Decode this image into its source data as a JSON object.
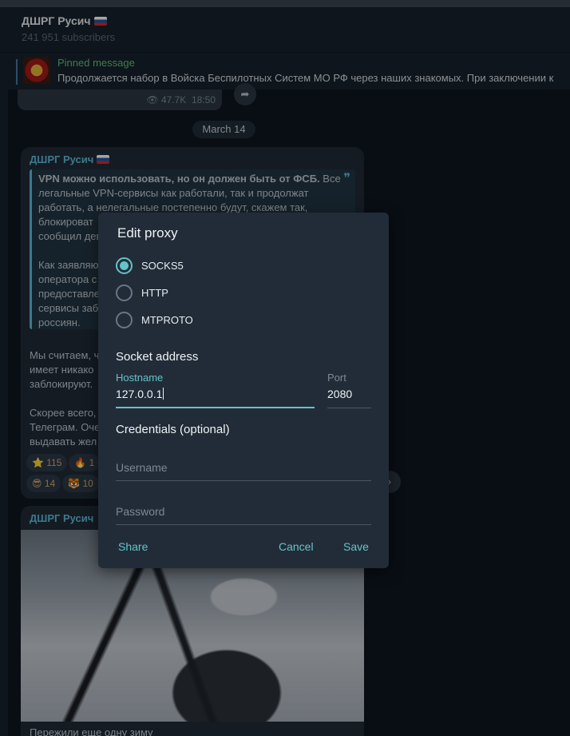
{
  "header": {
    "channel_name": "ДШРГ Русич",
    "subscribers": "241 951 subscribers"
  },
  "pinned": {
    "title": "Pinned message",
    "text": "Продолжается набор в Войска Беспилотных Систем МО РФ через наших знакомых.  При заключении к"
  },
  "prev_message": {
    "views": "47.7K",
    "time": "18:50"
  },
  "date_separator": "March 14",
  "message": {
    "author": "ДШРГ Русич",
    "quote_lines": [
      "VPN можно использовать, но он должен быть от ФСБ. Все легальные VPN-сервисы как работали, так и продолжат работать, а нелегальные постепенно будут, скажем так, блокироват",
      "сообщил дев",
      "Как заявляю",
      "оператора с",
      "предоставле",
      "сервисы заб",
      "россиян."
    ],
    "quote_bold": "VPN можно использовать, но он должен быть от ФСБ.",
    "quote_rest": " Все легальные VPN-сервисы как работали, так и продолжат работать, а нелегальные постепенно будут, скажем так, блокироват",
    "text_lines": [
      "Мы считаем, ч",
      "имеет никако",
      "заблокируют.",
      "Скорее всего,",
      "Телеграм. Оче",
      "выдавать жел"
    ],
    "reactions": [
      "⭐ 115",
      "🔥 1",
      "😎 14",
      "🐯 10"
    ]
  },
  "message2": {
    "author": "ДШРГ Русич",
    "caption": "Пережили еще одну зиму"
  },
  "dialog": {
    "title": "Edit proxy",
    "proxy_types": [
      {
        "label": "SOCKS5",
        "selected": true
      },
      {
        "label": "HTTP",
        "selected": false
      },
      {
        "label": "MTPROTO",
        "selected": false
      }
    ],
    "socket_section": "Socket address",
    "hostname_label": "Hostname",
    "hostname_value": "127.0.0.1",
    "port_label": "Port",
    "port_value": "2080",
    "credentials_section": "Credentials (optional)",
    "username_placeholder": "Username",
    "password_placeholder": "Password",
    "share_label": "Share",
    "cancel_label": "Cancel",
    "save_label": "Save"
  },
  "colors": {
    "accent": "#64c3c8",
    "dialog_bg": "#222c38",
    "chat_bg": "#0e1621"
  }
}
